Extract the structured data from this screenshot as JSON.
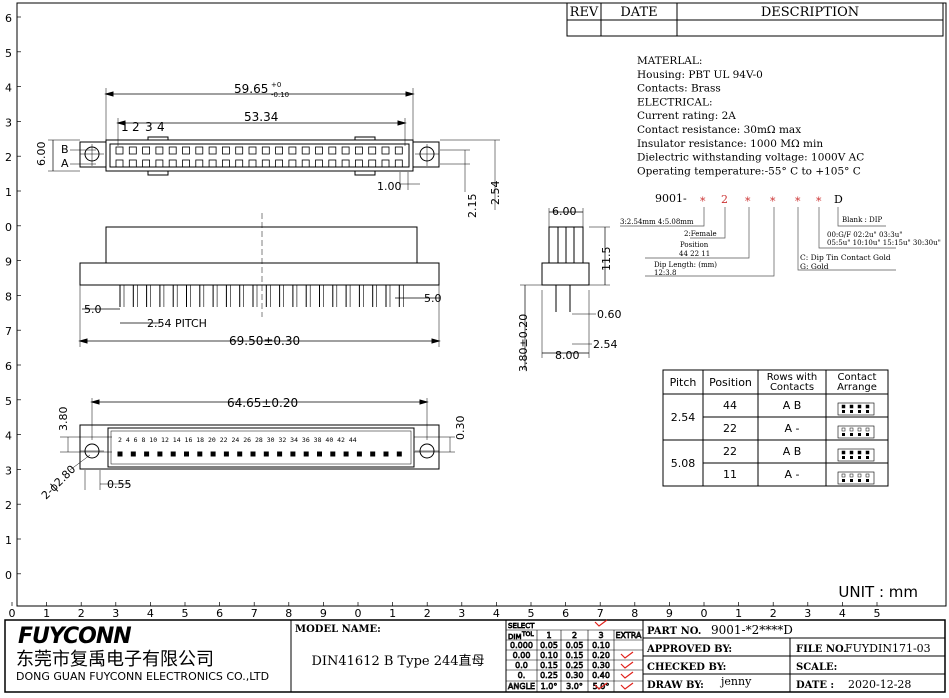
{
  "rev_table": {
    "rev": "REV",
    "date": "DATE",
    "description": "DESCRIPTION"
  },
  "left_ruler": [
    "6",
    "5",
    "4",
    "3",
    "2",
    "1",
    "0",
    "9",
    "8",
    "7",
    "6",
    "5",
    "4",
    "3",
    "2",
    "1",
    "0"
  ],
  "bottom_ruler": [
    "0",
    "1",
    "2",
    "3",
    "4",
    "5",
    "6",
    "7",
    "8",
    "9",
    "0",
    "1",
    "2",
    "3",
    "4",
    "5",
    "6",
    "7",
    "8",
    "9",
    "0",
    "1",
    "2",
    "3",
    "4",
    "5"
  ],
  "material": [
    "MATERLAL:",
    "Housing: PBT UL 94V-0",
    "Contacts: Brass",
    "ELECTRICAL:",
    "Current rating: 2A",
    "Contact resistance: 30mΩ max",
    "Insulator resistance: 1000 MΩ min",
    "Dielectric withstanding voltage: 1000V  AC",
    "Operating temperature:-55° C to +105° C"
  ],
  "part_code": {
    "prefix": "9001-",
    "star": "*",
    "two": "2",
    "d": "D",
    "pitch_note": "3:2.54mm    4:5.08mm",
    "female_note": "2:Female",
    "position_label": "Position",
    "position_values": "44 22 11",
    "dip_length_label": "Dip Length: (mm)",
    "dip_length_values": "12:3.8",
    "plating_1": "C: Dip Tin Contact Gold",
    "plating_2": "G: Gold",
    "gold_1": "00:G/F   02:2u\"   03:3u\"",
    "gold_2": "05:5u\"  10:10u\"  15:15u\" 30:30u\"",
    "blank_dip": "Blank : DIP"
  },
  "top_view": {
    "row_b": "B",
    "row_a": "A",
    "pins": [
      "1",
      "2",
      "3",
      "4"
    ],
    "dim_overall": "59.65",
    "dim_tol_plus": "+0",
    "dim_tol_minus": "-0.10",
    "dim_pins": "53.34",
    "dim_height": "6.00",
    "dim_pitch_small": "1.00",
    "dim_215": "2.15",
    "dim_254": "2.54"
  },
  "side_view": {
    "dim_50_left": "5.0",
    "dim_50_right": "5.0",
    "dim_pitch": "2.54  PITCH",
    "dim_width": "69.50±0.30"
  },
  "end_view": {
    "dim_600": "6.00",
    "dim_115": "11.5",
    "dim_380": "3.80±0.20",
    "dim_060": "0.60",
    "dim_800": "8.00",
    "dim_254": "2.54"
  },
  "pcb_view": {
    "dim_6465": "64.65±0.20",
    "dim_380": "3.80",
    "dim_hole": "2-ϕ2.80",
    "dim_055": "0.55",
    "dim_030": "0.30",
    "pin_labels": "2 4 6 8 10 12 14 16 18 20 22 24 26 28 30 32 34 36 38 40 42 44"
  },
  "pitch_table": {
    "headers": [
      "Pitch",
      "Position",
      "Rows with\nContacts",
      "Contact\nArrange"
    ],
    "rows": [
      {
        "pitch": "2.54",
        "position": "44",
        "rows": "A  B"
      },
      {
        "pitch": "",
        "position": "22",
        "rows": "A  -"
      },
      {
        "pitch": "5.08",
        "position": "22",
        "rows": "A  B"
      },
      {
        "pitch": "",
        "position": "11",
        "rows": "A  -"
      }
    ]
  },
  "unit": "UNIT  :  mm",
  "title_block": {
    "logo": "FUYCONN",
    "company_cn": "东莞市复禹电子有限公司",
    "company_en": "DONG GUAN FUYCONN ELECTRONICS CO.,LTD",
    "model_label": "MODEL NAME:",
    "model_value": "DIN41612 B Type 244直母",
    "select": "SELECT",
    "dim": "DIM",
    "tol": "TOL",
    "tol_cols": [
      "1",
      "2",
      "3",
      "EXTRA"
    ],
    "tol_rows": [
      [
        "0.000",
        "0.05",
        "0.05",
        "0.10"
      ],
      [
        "0.00",
        "0.10",
        "0.15",
        "0.20"
      ],
      [
        "0.0",
        "0.15",
        "0.25",
        "0.30"
      ],
      [
        "0.",
        "0.25",
        "0.30",
        "0.40"
      ],
      [
        "ANGLE",
        "1.0°",
        "3.0°",
        "5.0°"
      ]
    ],
    "part_no_label": "PART NO.",
    "part_no_value": "9001-*2****D",
    "approved_label": "APPROVED BY:",
    "file_no_label": "FILE NO.",
    "file_no_value": "FUYDIN171-03",
    "checked_label": "CHECKED BY:",
    "scale_label": "SCALE:",
    "draw_label": "DRAW BY:",
    "draw_value": "jenny",
    "date_label": "DATE :",
    "date_value": "2020-12-28"
  },
  "colors": {
    "check": "#e0201a",
    "line": "#000000"
  }
}
